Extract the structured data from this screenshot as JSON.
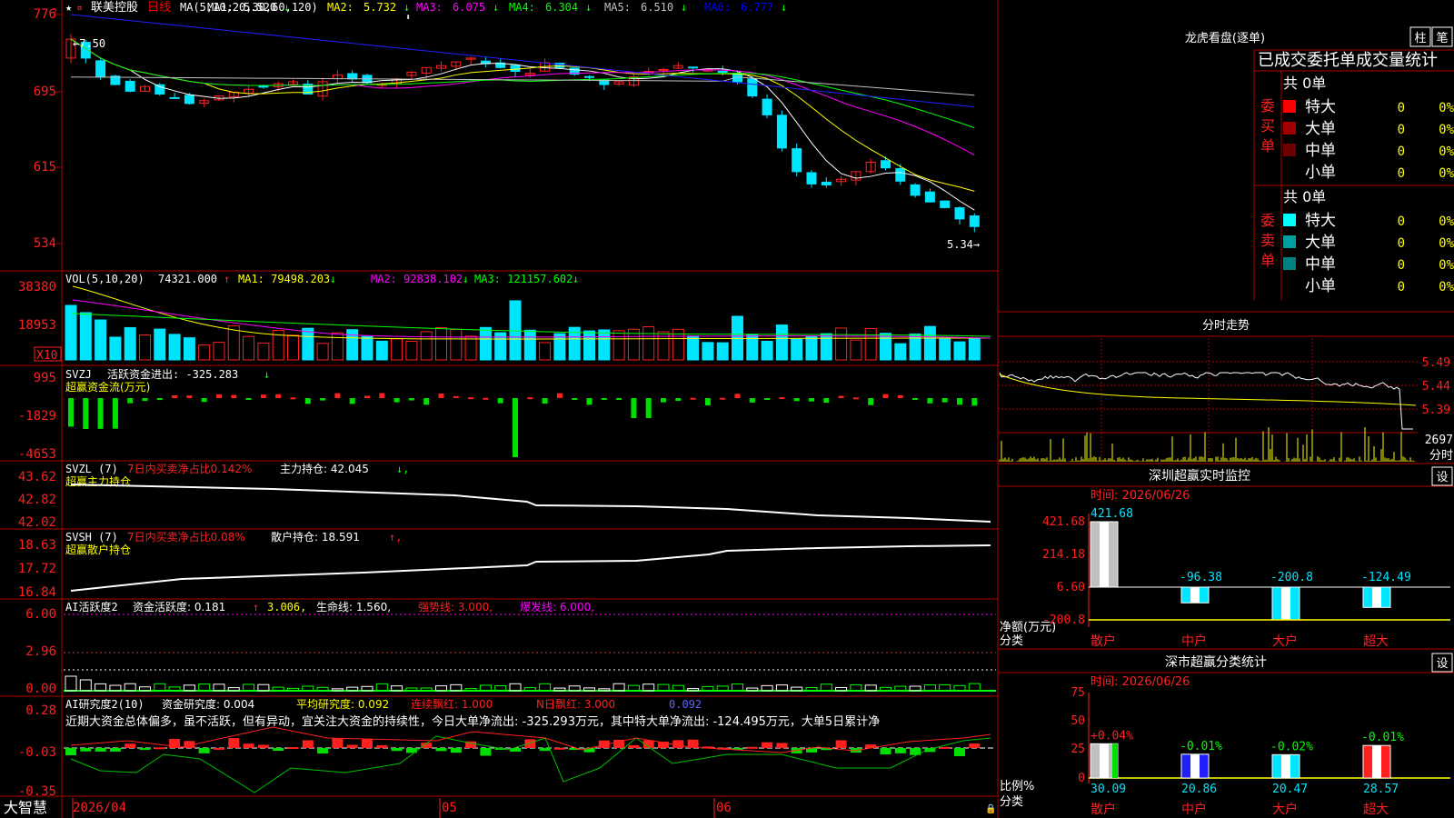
{
  "stock": {
    "name": "联美控股",
    "period": "日线",
    "ma_header": "MA(5,10,20,30,60,120)",
    "ma_items": [
      {
        "label": "MA1:",
        "value": "5.520",
        "arrow": "↓",
        "color": "#ffffff"
      },
      {
        "label": "MA2:",
        "value": "5.732",
        "arrow": "↓",
        "color": "#ffff00"
      },
      {
        "label": "MA3:",
        "value": "6.075",
        "arrow": "↓",
        "color": "#ff00ff"
      },
      {
        "label": "MA4:",
        "value": "6.304",
        "arrow": "↓",
        "color": "#00ff00"
      },
      {
        "label": "MA5:",
        "value": "6.510",
        "arrow": "↓",
        "color": "#c0c0c0"
      },
      {
        "label": "MA6:",
        "value": "6.777",
        "arrow": "↓",
        "color": "#0000ff"
      }
    ],
    "high_label": "7.50",
    "low_label": "5.34",
    "price_axis": [
      "776",
      "695",
      "615",
      "534"
    ]
  },
  "panels": {
    "vol": {
      "header": "VOL(5,10,20)",
      "value": "74321.000",
      "items": [
        {
          "label": "MA1:",
          "value": "79498.203",
          "arrow": "↓",
          "color": "#ffff00"
        },
        {
          "label": "MA2:",
          "value": "92838.102",
          "arrow": "↓",
          "color": "#ff00ff"
        },
        {
          "label": "MA3:",
          "value": "121157.602",
          "arrow": "↓",
          "color": "#00ff00"
        }
      ],
      "axis": [
        "38380",
        "18953"
      ],
      "unit": "X10"
    },
    "svzj": {
      "header": "SVZJ",
      "label": "活跃资金进出:",
      "value": "-325.283",
      "sub": "超赢资金流(万元)",
      "axis": [
        "995",
        "-1829",
        "-4653"
      ]
    },
    "svzl": {
      "header": "SVZL (7)",
      "label1": "7日内买卖净占比0.142%",
      "label2": "主力持仓:",
      "value": "42.045",
      "sub": "超赢主力持仓",
      "axis": [
        "43.62",
        "42.82",
        "42.02"
      ]
    },
    "svsh": {
      "header": "SVSH (7)",
      "label1": "7日内买卖净占比0.08%",
      "label2": "散户持仓:",
      "value": "18.591",
      "sub": "超赢散户持仓",
      "axis": [
        "18.63",
        "17.72",
        "16.84"
      ]
    },
    "ai1": {
      "header": "AI活跃度2",
      "label": "资金活跃度:",
      "v1": "0.181",
      "v2": "3.006,",
      "life": "生命线: 1.560,",
      "strong": "强势线: 3.000,",
      "burst": "爆发线: 6.000,",
      "axis": [
        "6.00",
        "2.96",
        "0.00"
      ]
    },
    "ai2": {
      "header": "AI研究度2(10)",
      "label": "资金研究度: 0.004",
      "avg": "平均研究度: 0.092",
      "cont": "连续飘红: 1.000",
      "nday": "N日飘红: 3.000",
      "last": "0.092",
      "comment": "近期大资金总体偏多，虽不活跃，但有异动，宜关注大资金的持续性，今日大单净流出: -325.293万元，其中特大单净流出: -124.495万元，大单5日累计净",
      "axis": [
        "0.28",
        "-0.03",
        "-0.35"
      ]
    }
  },
  "date_axis": [
    "2026/04",
    "05",
    "06"
  ],
  "brand": "大智慧",
  "right": {
    "lhkp_title": "龙虎看盘(逐单)",
    "btn_bar": "柱",
    "btn_bi": "笔",
    "stats_title": "已成交委托单成交量统计",
    "buy_side": "委买单",
    "sell_side": "委卖单",
    "buy_total": "共 0单",
    "sell_total": "共 0单",
    "buy_rows": [
      {
        "name": "特大",
        "count": "0",
        "pct": "0%",
        "color": "#ff0000"
      },
      {
        "name": "大单",
        "count": "0",
        "pct": "0%",
        "color": "#a00000"
      },
      {
        "name": "中单",
        "count": "0",
        "pct": "0%",
        "color": "#700000"
      },
      {
        "name": "小单",
        "count": "0",
        "pct": "0%",
        "color": "#000000"
      }
    ],
    "sell_rows": [
      {
        "name": "特大",
        "count": "0",
        "pct": "0%",
        "color": "#00ffff"
      },
      {
        "name": "大单",
        "count": "0",
        "pct": "0%",
        "color": "#00a0a0"
      },
      {
        "name": "中单",
        "count": "0",
        "pct": "0%",
        "color": "#008080"
      },
      {
        "name": "小单",
        "count": "0",
        "pct": "0%",
        "color": "#000000"
      }
    ],
    "intraday_title": "分时走势",
    "intraday_axis": [
      "5.49",
      "5.44",
      "5.39"
    ],
    "intraday_vol": "2697",
    "intraday_unit": "分时",
    "monitor_title": "深圳超赢实时监控",
    "monitor_time": "时间: 2026/06/26",
    "monitor_axis": [
      "421.68",
      "214.18",
      "6.60",
      "-200.8"
    ],
    "monitor_ylabel": "净额(万元)",
    "monitor_xlabel": "分类",
    "monitor_set": "设",
    "class_title": "深市超赢分类统计",
    "class_time": "时间: 2026/06/26",
    "class_axis": [
      "75",
      "50",
      "25",
      "0"
    ],
    "class_ylabel": "比例%",
    "class_xlabel": "分类",
    "class_set": "设"
  },
  "chart_data": [
    {
      "type": "bar",
      "title": "深圳超赢实时监控",
      "categories": [
        "散户",
        "中户",
        "大户",
        "超大"
      ],
      "values": [
        421.68,
        -96.38,
        -200.8,
        -124.49
      ],
      "ylabel": "净额(万元)",
      "ylim": [
        -200.8,
        421.68
      ]
    },
    {
      "type": "bar",
      "title": "深市超赢分类统计",
      "categories": [
        "散户",
        "中户",
        "大户",
        "超大"
      ],
      "values": [
        30.09,
        20.86,
        20.47,
        28.57
      ],
      "changes": [
        "+0.04%",
        "-0.01%",
        "-0.02%",
        "-0.01%"
      ],
      "ylabel": "比例%",
      "ylim": [
        0,
        75
      ]
    }
  ]
}
